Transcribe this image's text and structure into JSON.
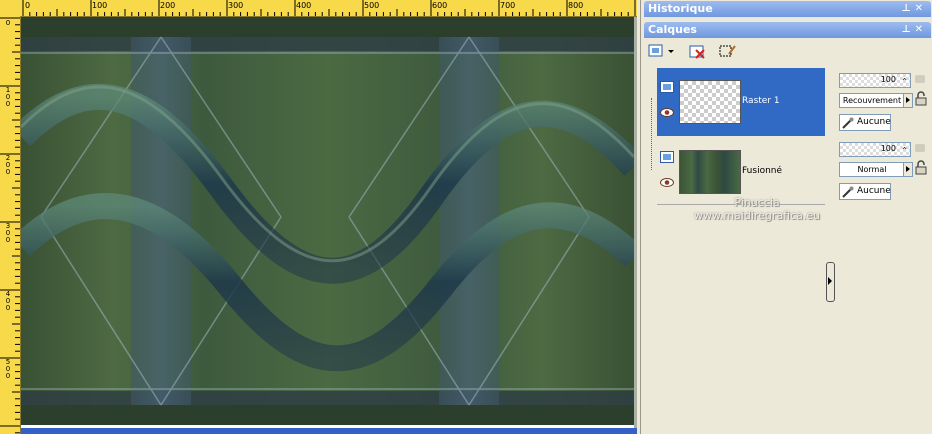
{
  "ruler_top": {
    "labels": [
      "0",
      "100",
      "200",
      "300",
      "400",
      "500",
      "600",
      "700",
      "800"
    ]
  },
  "ruler_left": {
    "labels": [
      [
        "0"
      ],
      [
        "1",
        "0",
        "0"
      ],
      [
        "2",
        "0",
        "0"
      ],
      [
        "3",
        "0",
        "0"
      ],
      [
        "4",
        "0",
        "0"
      ],
      [
        "5",
        "0",
        "0"
      ]
    ]
  },
  "panels": {
    "history": {
      "title": "Historique"
    },
    "layers": {
      "title": "Calques",
      "items": [
        {
          "name": "Raster 1",
          "opacity": "100",
          "blend_mode": "Recouvrement",
          "mask": "Aucune"
        },
        {
          "name": "Fusionné",
          "opacity": "100",
          "blend_mode": "Normal",
          "mask": "Aucune"
        }
      ]
    }
  },
  "watermark": {
    "line1": "Pinuccia",
    "line2": "www.maidiregrafica.eu"
  },
  "icons": {
    "pin": "pin-icon",
    "close": "close-icon",
    "new_layer": "new-layer-icon",
    "delete_layer": "delete-layer-icon",
    "edit_selection": "edit-selection-icon",
    "visibility": "eye-icon",
    "lock": "lock-icon",
    "mask": "mask-icon"
  },
  "colors": {
    "selected_row": "#316ac5",
    "panel_title": "#7aa2e4",
    "ruler": "#f7d94a"
  }
}
